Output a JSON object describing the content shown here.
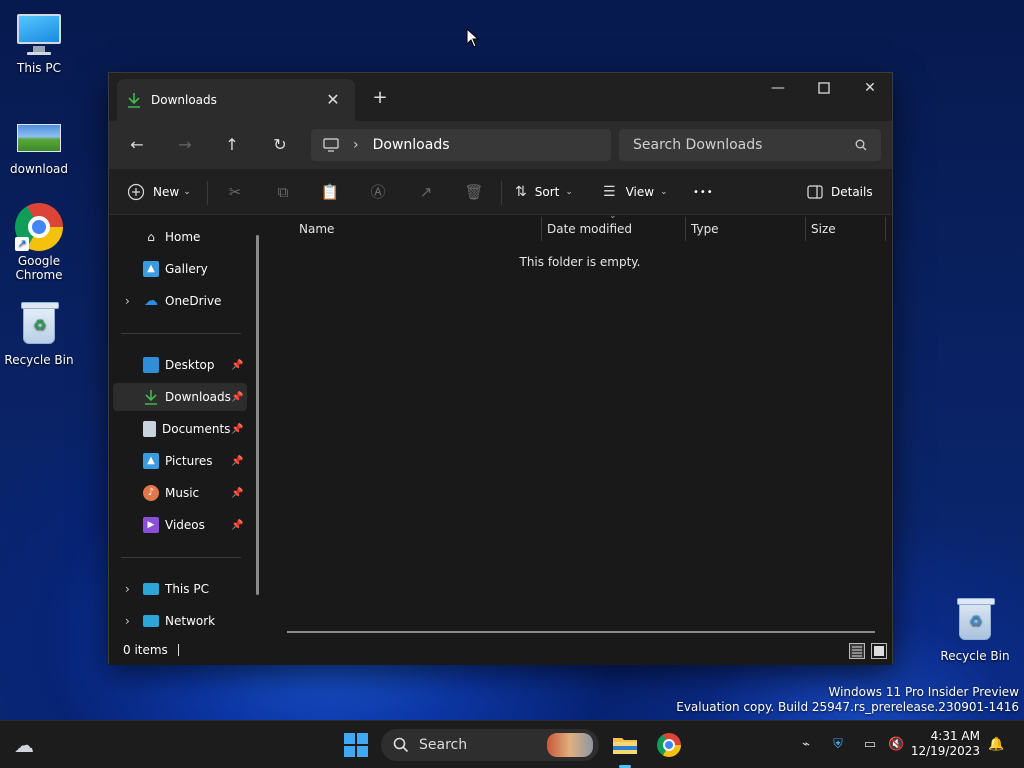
{
  "desktop": {
    "icons": [
      {
        "label": "This PC"
      },
      {
        "label": "download"
      },
      {
        "label": "Google Chrome"
      },
      {
        "label": "Recycle Bin"
      }
    ],
    "right_icon": {
      "label": "Recycle Bin"
    }
  },
  "explorer": {
    "tab_title": "Downloads",
    "breadcrumb": "Downloads",
    "search_placeholder": "Search Downloads",
    "toolbar": {
      "new_label": "New",
      "sort_label": "Sort",
      "view_label": "View",
      "more_label": "•••",
      "details_label": "Details"
    },
    "sidebar": {
      "home": "Home",
      "gallery": "Gallery",
      "onedrive": "OneDrive",
      "desktop": "Desktop",
      "downloads": "Downloads",
      "documents": "Documents",
      "pictures": "Pictures",
      "music": "Music",
      "videos": "Videos",
      "thispc": "This PC",
      "network": "Network"
    },
    "columns": {
      "name": "Name",
      "date": "Date modified",
      "type": "Type",
      "size": "Size"
    },
    "empty_message": "This folder is empty.",
    "status": "0 items"
  },
  "watermark": {
    "line1": "Windows 11 Pro Insider Preview",
    "line2": "Evaluation copy. Build 25947.rs_prerelease.230901-1416"
  },
  "taskbar": {
    "search_label": "Search",
    "time": "4:31 AM",
    "date": "12/19/2023"
  },
  "colors": {
    "accent": "#4cc2ff",
    "download_green": "#3fb950"
  }
}
